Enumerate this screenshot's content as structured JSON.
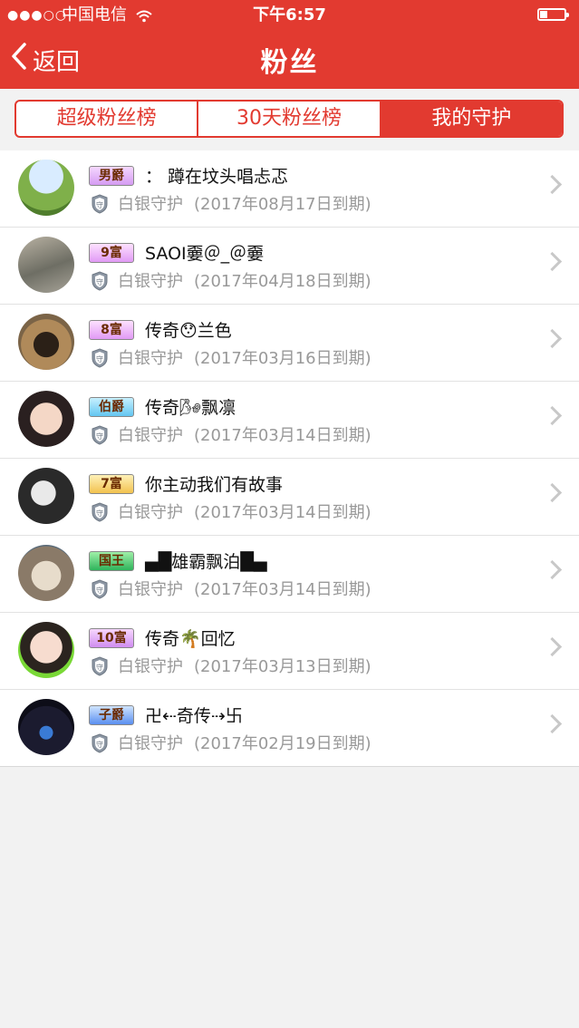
{
  "status_bar": {
    "signal": "●●●○○",
    "carrier": "中国电信",
    "wifi_icon": "wifi-icon",
    "time": "下午6:57",
    "battery_icon": "battery-icon"
  },
  "nav": {
    "back_label": "返回",
    "title": "粉丝"
  },
  "tabs": [
    {
      "label": "超级粉丝榜",
      "active": false
    },
    {
      "label": "30天粉丝榜",
      "active": false
    },
    {
      "label": "我的守护",
      "active": true
    }
  ],
  "colors": {
    "brand_red": "#e23a30",
    "muted_text": "#999999"
  },
  "fans": [
    {
      "badge": "男爵",
      "name": "： 蹲在坟头唱忐忑",
      "guard": "白银守护",
      "expiry": "(2017年08月17日到期)"
    },
    {
      "badge": "9富",
      "name": "SAOI嫑＠_＠嫑",
      "guard": "白银守护",
      "expiry": "(2017年04月18日到期)"
    },
    {
      "badge": "8富",
      "name": "传奇😯兰色",
      "guard": "白银守护",
      "expiry": "(2017年03月16日到期)"
    },
    {
      "badge": "伯爵",
      "name": "传奇🌬飘凛",
      "guard": "白银守护",
      "expiry": "(2017年03月14日到期)"
    },
    {
      "badge": "7富",
      "name": "你主动我们有故事",
      "guard": "白银守护",
      "expiry": "(2017年03月14日到期)"
    },
    {
      "badge": "国王",
      "name": "▄█雄霸飘泊█▄",
      "guard": "白银守护",
      "expiry": "(2017年03月14日到期)"
    },
    {
      "badge": "10富",
      "name": "传奇🌴回忆",
      "guard": "白银守护",
      "expiry": "(2017年03月13日到期)"
    },
    {
      "badge": "子爵",
      "name": "卍⇠奇传⇢卐",
      "guard": "白银守护",
      "expiry": "(2017年02月19日到期)"
    }
  ]
}
